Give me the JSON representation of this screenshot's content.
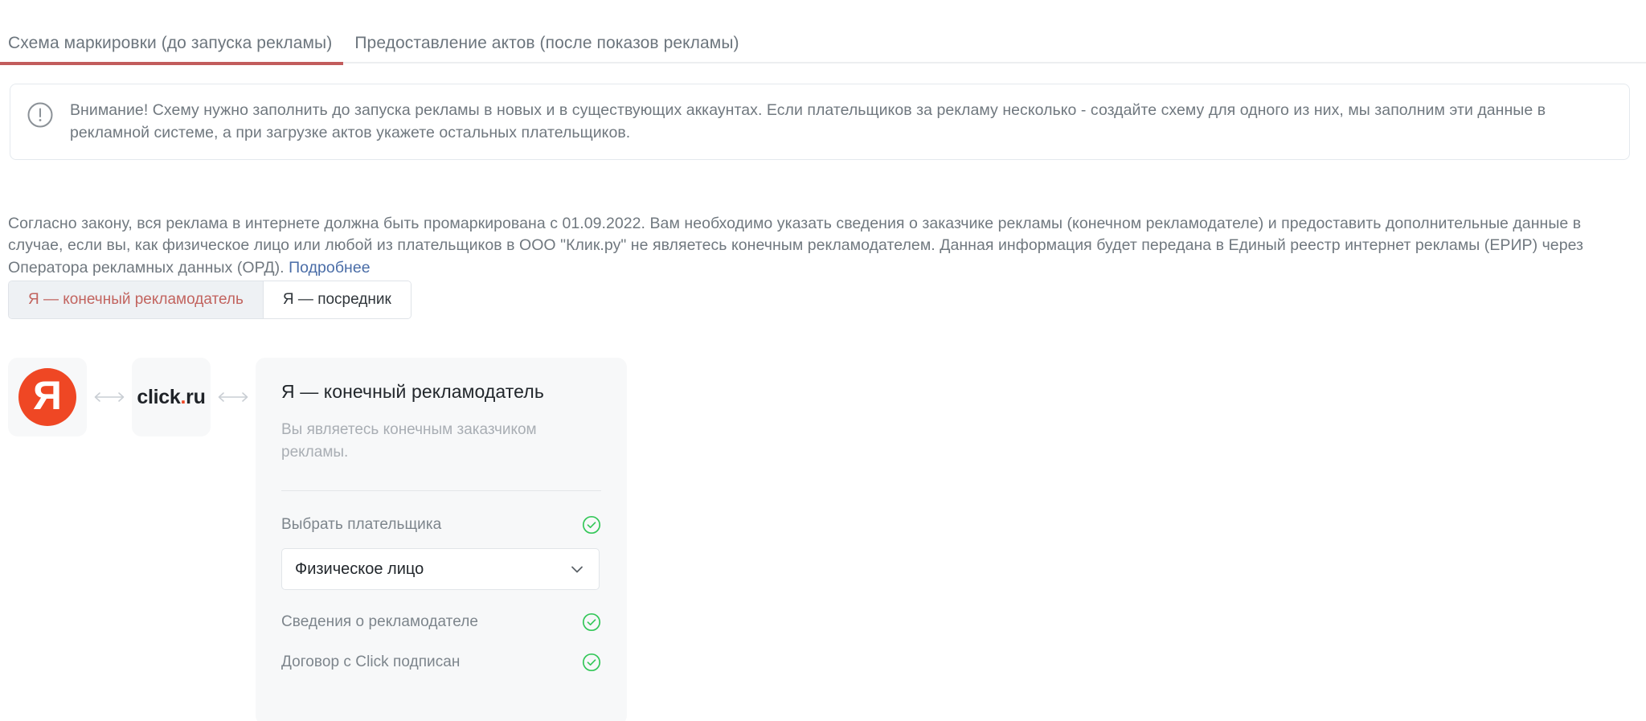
{
  "theme": {
    "accent": "#c25c5c",
    "link": "#4a6da7",
    "brand_red": "#ef4724",
    "success_green": "#34c759",
    "muted_text": "#70787f"
  },
  "tabs": [
    {
      "label": "Схема маркировки (до запуска рекламы)",
      "active": true
    },
    {
      "label": "Предоставление актов (после показов рекламы)",
      "active": false
    }
  ],
  "alert": {
    "icon": "exclamation-circle-icon",
    "text": "Внимание! Схему нужно заполнить до запуска рекламы в новых и в существующих аккаунтах. Если плательщиков за рекламу несколько - создайте схему для одного из них, мы заполним эти данные в рекламной системе, а при загрузке актов укажете остальных плательщиков."
  },
  "intro": {
    "text": "Согласно закону, вся реклама в интернете должна быть промаркирована с 01.09.2022. Вам необходимо указать сведения о заказчике рекламы (конечном рекламодателе) и предоставить дополнительные данные в случае, если вы, как физическое лицо или любой из плательщиков в ООО \"Клик.ру\" не являетесь конечным рекламодателем. Данная информация будет передана в Единый реестр интернет рекламы (ЕРИР) через Оператора рекламных данных (ОРД). ",
    "link_label": "Подробнее"
  },
  "role_switch": {
    "options": [
      {
        "label": "Я — конечный рекламодатель",
        "active": true
      },
      {
        "label": "Я — посредник",
        "active": false
      }
    ]
  },
  "flow": {
    "yandex_logo": {
      "icon": "yandex-logo-icon",
      "glyph": "Я"
    },
    "arrow_glyph": "⟷",
    "clickru_logo": {
      "icon": "clickru-logo-icon",
      "part1": "click",
      "dot": ".",
      "part2": "ru"
    }
  },
  "card": {
    "title": "Я — конечный рекламодатель",
    "description": "Вы являетесь конечным заказчиком рекламы.",
    "payer_label": "Выбрать плательщика",
    "payer_value": "Физическое лицо",
    "payer_status_icon": "check-circle-icon",
    "rows": [
      {
        "label": "Сведения о рекламодателе",
        "status_icon": "check-circle-icon"
      },
      {
        "label": "Договор с Click подписан",
        "status_icon": "check-circle-icon"
      }
    ]
  }
}
